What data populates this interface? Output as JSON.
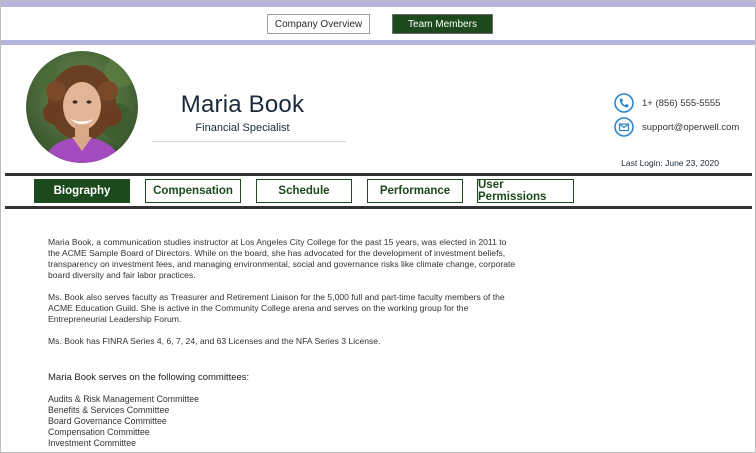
{
  "nav": {
    "company_overview": "Company Overview",
    "team_members": "Team Members"
  },
  "profile": {
    "name": "Maria Book",
    "title": "Financial Specialist",
    "phone": "1+ (856) 555-5555",
    "email": "support@operwell.com",
    "last_login": "Last Login: June 23, 2020"
  },
  "tabs": [
    {
      "label": "Biography",
      "active": true
    },
    {
      "label": "Compensation",
      "active": false
    },
    {
      "label": "Schedule",
      "active": false
    },
    {
      "label": "Performance",
      "active": false
    },
    {
      "label": "User Permissions",
      "active": false
    }
  ],
  "bio": {
    "p1": "Maria Book, a communication studies instructor at Los Angeles City College for the past 15 years, was elected in 2011 to the ACME Sample Board of Directors. While on the board, she has advocated for the development of investment beliefs, transparency on investment fees, and managing environmental, social and governance risks like climate change, corporate board diversity and fair labor practices.",
    "p2": "Ms. Book also serves faculty as Treasurer and Retirement Liaison for the 5,000 full and part-time faculty members of the ACME Education Guild.  She is active in the Community College arena and serves on the working group for the Entrepreneurial Leadership Forum.",
    "p3": "Ms. Book has FINRA Series  4, 6, 7, 24, and 63 Licenses and the NFA Series 3 License.",
    "committees_heading": "Maria Book serves on the following committees:",
    "committees": [
      "Audits & Risk Management Committee",
      "Benefits & Services Committee",
      "Board Governance Committee",
      "Compensation Committee",
      "Investment Committee"
    ]
  },
  "colors": {
    "accent_green": "#1c4a1d",
    "band_lavender": "#b4b4de",
    "icon_blue": "#2a86c8"
  },
  "icons": {
    "phone": "phone-icon",
    "email": "email-icon"
  }
}
